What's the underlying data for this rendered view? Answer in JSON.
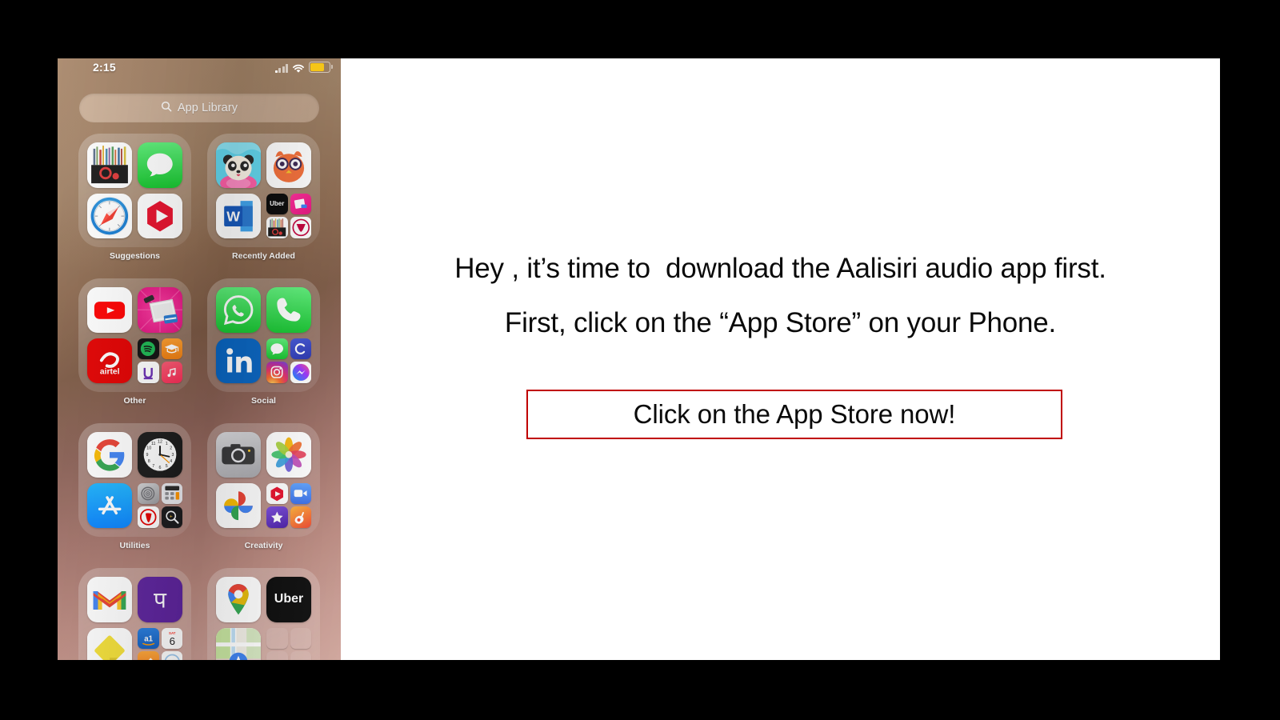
{
  "slide": {
    "background_color": "#ffffff",
    "canvas_color": "#000000",
    "lines": [
      "Hey , it’s time to  download the Aalisiri audio app first.",
      "First, click on the “App Store” on your Phone."
    ],
    "cta": {
      "text": "Click on the App Store now!",
      "border_color": "#c00000"
    }
  },
  "phone": {
    "status_bar": {
      "time": "2:15",
      "signal_icon": "cellular-signal-icon",
      "wifi_icon": "wifi-icon",
      "battery_icon": "battery-icon",
      "battery_color": "#f5c518"
    },
    "search": {
      "label": "App Library",
      "icon": "search-icon"
    },
    "folders": [
      {
        "label": "Suggestions",
        "cells": [
          {
            "type": "app",
            "name": "barcode-scanner-app"
          },
          {
            "type": "app",
            "name": "messages-app"
          },
          {
            "type": "app",
            "name": "safari-app"
          },
          {
            "type": "app",
            "name": "vlc-media-app"
          }
        ]
      },
      {
        "label": "Recently Added",
        "cells": [
          {
            "type": "app",
            "name": "panda-kids-app"
          },
          {
            "type": "app",
            "name": "duolingo-owl-app"
          },
          {
            "type": "app",
            "name": "microsoft-word-app"
          },
          {
            "type": "cluster",
            "apps": [
              "uber-app",
              "billing-pink-app",
              "scanner-app",
              "vlr-red-app"
            ]
          }
        ]
      },
      {
        "label": "Other",
        "cells": [
          {
            "type": "app",
            "name": "youtube-app"
          },
          {
            "type": "app",
            "name": "billing-scanner-app"
          },
          {
            "type": "app",
            "name": "airtel-app"
          },
          {
            "type": "cluster",
            "apps": [
              "spotify-app",
              "graduation-edu-app",
              "urban-company-app",
              "apple-music-app"
            ]
          }
        ]
      },
      {
        "label": "Social",
        "cells": [
          {
            "type": "app",
            "name": "whatsapp-app"
          },
          {
            "type": "app",
            "name": "phone-app"
          },
          {
            "type": "app",
            "name": "linkedin-app"
          },
          {
            "type": "cluster",
            "apps": [
              "messages-app",
              "chrome-c-app",
              "instagram-app",
              "messenger-app"
            ]
          }
        ]
      },
      {
        "label": "Utilities",
        "cells": [
          {
            "type": "app",
            "name": "google-app"
          },
          {
            "type": "app",
            "name": "clock-app"
          },
          {
            "type": "app",
            "name": "app-store-app"
          },
          {
            "type": "cluster",
            "apps": [
              "settings-app",
              "calculator-app",
              "vodafone-app",
              "magnifier-app"
            ]
          }
        ]
      },
      {
        "label": "Creativity",
        "cells": [
          {
            "type": "app",
            "name": "camera-app"
          },
          {
            "type": "app",
            "name": "photos-app"
          },
          {
            "type": "app",
            "name": "google-photos-app"
          },
          {
            "type": "cluster",
            "apps": [
              "vlc-media-app",
              "facetime-app",
              "imovie-app",
              "garageband-app"
            ]
          }
        ]
      },
      {
        "label": "",
        "cells": [
          {
            "type": "app",
            "name": "gmail-app"
          },
          {
            "type": "app",
            "name": "phonepe-app"
          },
          {
            "type": "app",
            "name": "notes-app"
          },
          {
            "type": "cluster",
            "apps": [
              "amazon-alexa-app",
              "calendar-app",
              "files-orange-app",
              "mail-app"
            ]
          }
        ]
      },
      {
        "label": "",
        "cells": [
          {
            "type": "app",
            "name": "google-maps-app"
          },
          {
            "type": "app",
            "name": "uber-app"
          },
          {
            "type": "app",
            "name": "apple-maps-app"
          },
          {
            "type": "cluster",
            "apps": [
              "blank-app",
              "blank-app",
              "blank-app",
              "blank-app"
            ]
          }
        ]
      }
    ]
  }
}
